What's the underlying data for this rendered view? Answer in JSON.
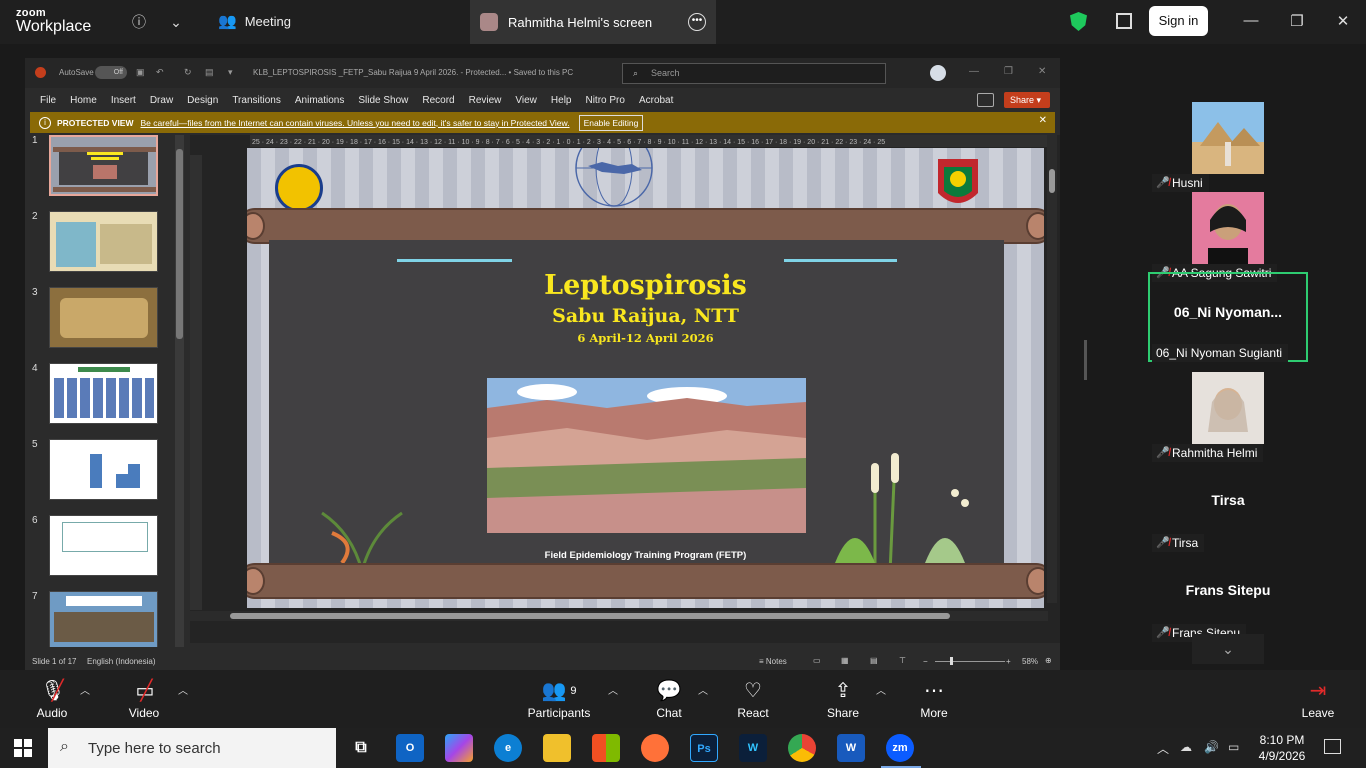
{
  "zoom": {
    "brand_top": "zoom",
    "brand_bottom": "Workplace",
    "meeting_tab": "Meeting",
    "screen_tab": "Rahmitha Helmi's screen",
    "sign_in": "Sign in"
  },
  "ppt": {
    "autosave_label": "AutoSave",
    "autosave_state": "Off",
    "doc_title": "KLB_LEPTOSPIROSIS _FETP_Sabu Raijua 9 April 2026.  -  Protected...  •  Saved to this PC",
    "search_placeholder": "Search",
    "ribbon_tabs": [
      "File",
      "Home",
      "Insert",
      "Draw",
      "Design",
      "Transitions",
      "Animations",
      "Slide Show",
      "Record",
      "Review",
      "View",
      "Help",
      "Nitro Pro",
      "Acrobat"
    ],
    "share_label": "Share",
    "protected_label": "PROTECTED VIEW",
    "protected_msg": "Be careful—files from the Internet can contain viruses. Unless you need to edit, it's safer to stay in Protected View.",
    "enable_editing": "Enable Editing",
    "status_slide": "Slide 1 of 17",
    "status_lang": "English (Indonesia)",
    "notes_label": "Notes",
    "zoom_level": "58%",
    "thumb_numbers": [
      "1",
      "2",
      "3",
      "4",
      "5",
      "6",
      "7"
    ]
  },
  "slide": {
    "title": "Leptospirosis",
    "subtitle": "Sabu Raijua, NTT",
    "dates": "6 April-12 April 2026",
    "footer": "Field Epidemiology Training Program (FETP)"
  },
  "participants": [
    {
      "name": "Husni"
    },
    {
      "name": "AA Sagung Sawitri"
    },
    {
      "display": "06_Ni  Nyoman...",
      "name": "06_Ni Nyoman Sugianti"
    },
    {
      "name": "Rahmitha Helmi"
    },
    {
      "display": "Tirsa",
      "name": "Tirsa"
    },
    {
      "display": "Frans Sitepu",
      "name": "Frans Sitepu"
    }
  ],
  "toolbar": {
    "audio": "Audio",
    "video": "Video",
    "participants": "Participants",
    "participants_count": "9",
    "chat": "Chat",
    "react": "React",
    "share": "Share",
    "more": "More",
    "leave": "Leave"
  },
  "taskbar": {
    "search_placeholder": "Type here to search",
    "time": "8:10 PM",
    "date": "4/9/2026"
  },
  "colors": {
    "accent_green": "#2ecc71",
    "slide_title": "#f9e71f",
    "protected_bar": "#8a6a07",
    "ppt_red": "#c43e1c"
  }
}
